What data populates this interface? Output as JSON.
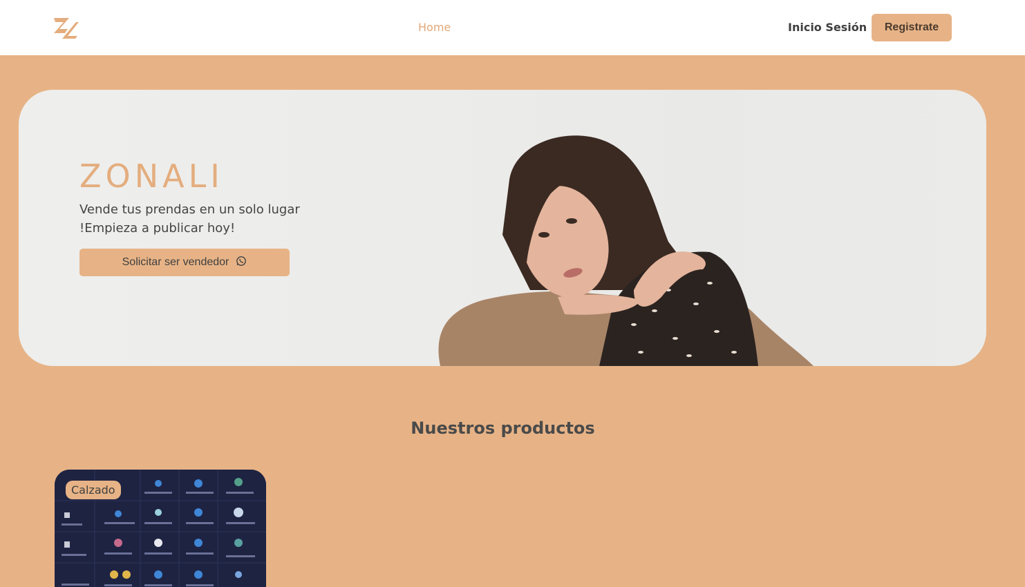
{
  "header": {
    "nav_home": "Home",
    "login": "Inicio Sesión",
    "register": "Registrate"
  },
  "hero": {
    "title": "ZONALI",
    "subtitle": "Vende tus prendas en un solo lugar !Empieza a publicar hoy!",
    "cta": "Solicitar ser vendedor",
    "cta_icon": "whatsapp-icon"
  },
  "products": {
    "title": "Nuestros productos",
    "items": [
      {
        "badge": "Calzado"
      }
    ]
  },
  "colors": {
    "accent": "#e7b386",
    "accent_text": "#e2a877",
    "page_bg": "#e7b386",
    "header_bg": "#ffffff"
  }
}
